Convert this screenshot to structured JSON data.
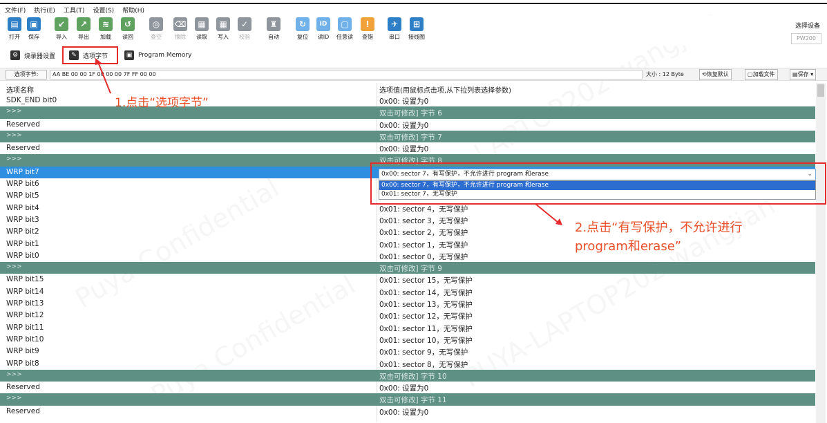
{
  "menu": [
    "文件(F)",
    "执行(E)",
    "工具(T)",
    "设置(S)",
    "帮助(H)"
  ],
  "toolbar": [
    {
      "label": "打开",
      "icon": "open-icon",
      "color": "blue",
      "enabled": true
    },
    {
      "label": "保存",
      "icon": "save-icon",
      "color": "blue",
      "enabled": true
    },
    {
      "label": "导入",
      "icon": "import-icon",
      "color": "green",
      "enabled": true
    },
    {
      "label": "导出",
      "icon": "export-icon",
      "color": "green",
      "enabled": true
    },
    {
      "label": "加载",
      "icon": "load-icon",
      "color": "green",
      "enabled": true
    },
    {
      "label": "读回",
      "icon": "readback-icon",
      "color": "green",
      "enabled": true
    },
    {
      "label": "查空",
      "icon": "blank-check-icon",
      "color": "gray",
      "enabled": false
    },
    {
      "label": "擦除",
      "icon": "erase-icon",
      "color": "gray",
      "enabled": false
    },
    {
      "label": "读取",
      "icon": "read-icon",
      "color": "gray",
      "enabled": true
    },
    {
      "label": "写入",
      "icon": "write-icon",
      "color": "gray",
      "enabled": true
    },
    {
      "label": "校验",
      "icon": "verify-icon",
      "color": "gray",
      "enabled": false
    },
    {
      "label": "自动",
      "icon": "auto-icon",
      "color": "gray",
      "enabled": true
    },
    {
      "label": "复位",
      "icon": "reset-icon",
      "color": "lblue",
      "enabled": true
    },
    {
      "label": "读ID",
      "icon": "read-id-icon",
      "color": "lblue",
      "enabled": true
    },
    {
      "label": "任意读",
      "icon": "any-read-icon",
      "color": "lblue",
      "enabled": true
    },
    {
      "label": "查错",
      "icon": "error-check-icon",
      "color": "orange",
      "enabled": true
    },
    {
      "label": "串口",
      "icon": "serial-port-icon",
      "color": "blue",
      "enabled": true
    },
    {
      "label": "接线图",
      "icon": "wiring-diagram-icon",
      "color": "blue",
      "enabled": true
    }
  ],
  "device": {
    "label": "选择设备",
    "value": "PW200"
  },
  "tabs": {
    "programmer_settings": "烧录器设置",
    "option_bytes": "选项字节",
    "program_memory": "Program Memory"
  },
  "option_bar": {
    "label": "选项字节:",
    "value": "AA BE 00 00 1F 00 00 00 7F FF 00 00",
    "size": "大小 : 12 Byte",
    "restore_default": "恢复默认",
    "load_file": "加载文件",
    "save": "保存"
  },
  "grid": {
    "col1": "选项名称",
    "col2": "选项值(用鼠标点击项,从下拉列表选择参数)",
    "rows": [
      {
        "name": "SDK_END bit0",
        "value": "0x00: 设置为0",
        "type": "normal"
      },
      {
        "name": ">>>",
        "value": "双击可修改] 字节 6",
        "type": "group"
      },
      {
        "name": "Reserved",
        "value": "0x00: 设置为0",
        "type": "normal"
      },
      {
        "name": ">>>",
        "value": "双击可修改] 字节 7",
        "type": "group"
      },
      {
        "name": "Reserved",
        "value": "0x00: 设置为0",
        "type": "normal"
      },
      {
        "name": ">>>",
        "value": "双击可修改] 字节 8",
        "type": "group"
      },
      {
        "name": "WRP bit7",
        "value": "",
        "type": "sel"
      },
      {
        "name": "WRP bit6",
        "value": "",
        "type": "normal"
      },
      {
        "name": "WRP bit5",
        "value": "",
        "type": "normal"
      },
      {
        "name": "WRP bit4",
        "value": "0x01: sector 4，无写保护",
        "type": "normal"
      },
      {
        "name": "WRP bit3",
        "value": "0x01: sector 3，无写保护",
        "type": "normal"
      },
      {
        "name": "WRP bit2",
        "value": "0x01: sector 2，无写保护",
        "type": "normal"
      },
      {
        "name": "WRP bit1",
        "value": "0x01: sector 1，无写保护",
        "type": "normal"
      },
      {
        "name": "WRP bit0",
        "value": "0x01: sector 0，无写保护",
        "type": "normal"
      },
      {
        "name": ">>>",
        "value": "双击可修改] 字节 9",
        "type": "group"
      },
      {
        "name": "WRP bit15",
        "value": "0x01: sector 15，无写保护",
        "type": "normal"
      },
      {
        "name": "WRP bit14",
        "value": "0x01: sector 14，无写保护",
        "type": "normal"
      },
      {
        "name": "WRP bit13",
        "value": "0x01: sector 13，无写保护",
        "type": "normal"
      },
      {
        "name": "WRP bit12",
        "value": "0x01: sector 12，无写保护",
        "type": "normal"
      },
      {
        "name": "WRP bit11",
        "value": "0x01: sector 11，无写保护",
        "type": "normal"
      },
      {
        "name": "WRP bit10",
        "value": "0x01: sector 10，无写保护",
        "type": "normal"
      },
      {
        "name": "WRP bit9",
        "value": "0x01: sector 9，无写保护",
        "type": "normal"
      },
      {
        "name": "WRP bit8",
        "value": "0x01: sector 8，无写保护",
        "type": "normal"
      },
      {
        "name": ">>>",
        "value": "双击可修改] 字节 10",
        "type": "group"
      },
      {
        "name": "Reserved",
        "value": "0x00: 设置为0",
        "type": "normal"
      },
      {
        "name": ">>>",
        "value": "双击可修改] 字节 11",
        "type": "group"
      },
      {
        "name": "Reserved",
        "value": "0x00: 设置为0",
        "type": "normal"
      }
    ]
  },
  "dropdown": {
    "current": "0x00: sector 7，有写保护，不允许进行 program 和erase",
    "options": [
      "0x00: sector 7，有写保护，不允许进行 program 和erase",
      "0x01: sector 7，无写保护"
    ]
  },
  "annotations": {
    "step1": "1.点击“选项字节”",
    "step2_line1": "2.点击“有写保护，不允许进行",
    "step2_line2": "program和erase”"
  },
  "watermark": [
    "Puya Confidential",
    "PUYA-LAPTOP202 wangjian"
  ]
}
